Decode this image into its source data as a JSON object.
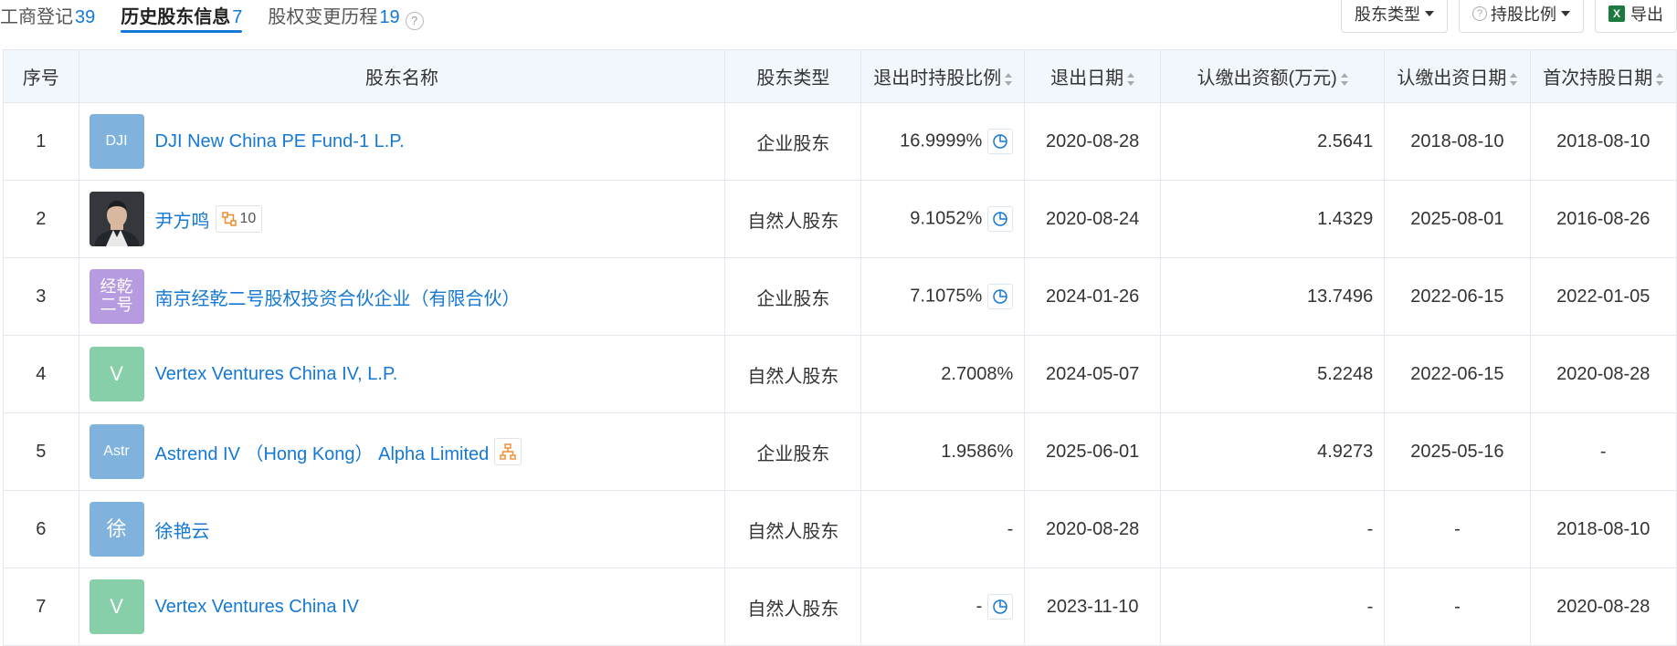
{
  "tabs": [
    {
      "label": "工商登记",
      "count": "39"
    },
    {
      "label": "历史股东信息",
      "count": "7"
    },
    {
      "label": "股权变更历程",
      "count": "19"
    }
  ],
  "help_icon": "?",
  "actions": {
    "type_filter": "股东类型",
    "ratio_filter": "持股比例",
    "export": "导出",
    "excel_icon_text": "X"
  },
  "table": {
    "headers": {
      "idx": "序号",
      "name": "股东名称",
      "type": "股东类型",
      "ratio": "退出时持股比例",
      "exit_date": "退出日期",
      "amount": "认缴出资额(万元)",
      "sub_date": "认缴出资日期",
      "first_date": "首次持股日期"
    },
    "rows": [
      {
        "idx": "1",
        "avatar": "DJI",
        "avatar_color": "#7fb2dc",
        "name": "DJI New China PE Fund-1 L.P.",
        "type": "企业股东",
        "ratio": "16.9999%",
        "exit_date": "2020-08-28",
        "amount": "2.5641",
        "sub_date": "2018-08-10",
        "first_date": "2018-08-10"
      },
      {
        "idx": "2",
        "avatar": "",
        "avatar_color": "#2e3237",
        "name": "尹方鸣",
        "badge_count": "10",
        "type": "自然人股东",
        "ratio": "9.1052%",
        "exit_date": "2020-08-24",
        "amount": "1.4329",
        "sub_date": "2025-08-01",
        "first_date": "2016-08-26"
      },
      {
        "idx": "3",
        "avatar": "经乾\n二号",
        "avatar_line1": "经乾",
        "avatar_line2": "二号",
        "avatar_color": "#b79be0",
        "name": "南京经乾二号股权投资合伙企业（有限合伙）",
        "type": "企业股东",
        "ratio": "7.1075%",
        "exit_date": "2024-01-26",
        "amount": "13.7496",
        "sub_date": "2022-06-15",
        "first_date": "2022-01-05"
      },
      {
        "idx": "4",
        "avatar": "V",
        "avatar_color": "#86cfa9",
        "name": "Vertex Ventures China IV, L.P.",
        "type": "自然人股东",
        "ratio": "2.7008%",
        "exit_date": "2024-05-07",
        "amount": "5.2248",
        "sub_date": "2022-06-15",
        "first_date": "2020-08-28"
      },
      {
        "idx": "5",
        "avatar": "Astr",
        "avatar_color": "#7fb2dc",
        "name": "Astrend IV （Hong Kong） Alpha Limited",
        "type": "企业股东",
        "ratio": "1.9586%",
        "exit_date": "2025-06-01",
        "amount": "4.9273",
        "sub_date": "2025-05-16",
        "first_date": "-"
      },
      {
        "idx": "6",
        "avatar": "徐",
        "avatar_color": "#7fb2dc",
        "name": "徐艳云",
        "type": "自然人股东",
        "ratio": "-",
        "exit_date": "2020-08-28",
        "amount": "-",
        "sub_date": "-",
        "first_date": "2018-08-10"
      },
      {
        "idx": "7",
        "avatar": "V",
        "avatar_color": "#86cfa9",
        "name": "Vertex Ventures China IV",
        "type": "自然人股东",
        "ratio": "-",
        "exit_date": "2023-11-10",
        "amount": "-",
        "sub_date": "-",
        "first_date": "2020-08-28"
      }
    ]
  },
  "colors": {
    "accent": "#1478d4",
    "header_bg": "#f2f7fd",
    "orange": "#f08c2e"
  }
}
